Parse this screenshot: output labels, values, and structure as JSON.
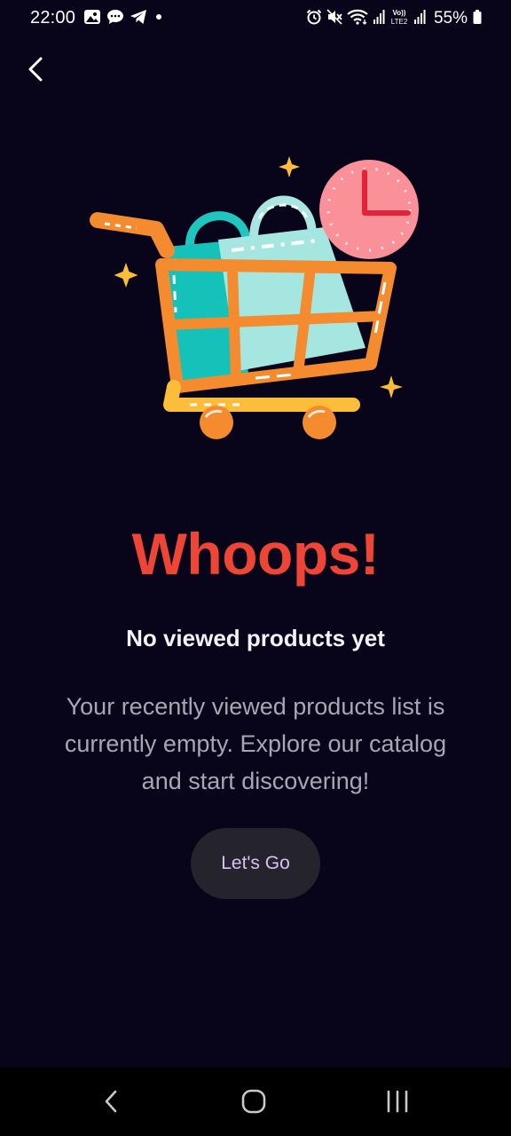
{
  "status_bar": {
    "time": "22:00",
    "battery": "55%",
    "left_icons": [
      "gallery-icon",
      "chat-icon",
      "telegram-icon",
      "dot-icon"
    ],
    "right_icons": [
      "alarm-icon",
      "mute-icon",
      "wifi-icon",
      "signal-icon",
      "volte-icon",
      "signal-icon",
      "battery-icon"
    ]
  },
  "header": {
    "back_icon": "chevron-left-icon"
  },
  "empty_state": {
    "illustration": "shopping-cart-clock-illustration",
    "headline": "Whoops!",
    "subtitle": "No viewed products yet",
    "description": "Your recently viewed products list is currently empty. Explore our catalog and start discovering!",
    "cta_label": "Let's Go"
  },
  "colors": {
    "background": "#080419",
    "headline": "#ef4537",
    "button_bg": "#25232b",
    "button_text": "#d5c3f5",
    "description": "#a9a6b3"
  },
  "nav_bar": {
    "buttons": [
      "back-nav-icon",
      "home-nav-icon",
      "recents-nav-icon"
    ]
  }
}
